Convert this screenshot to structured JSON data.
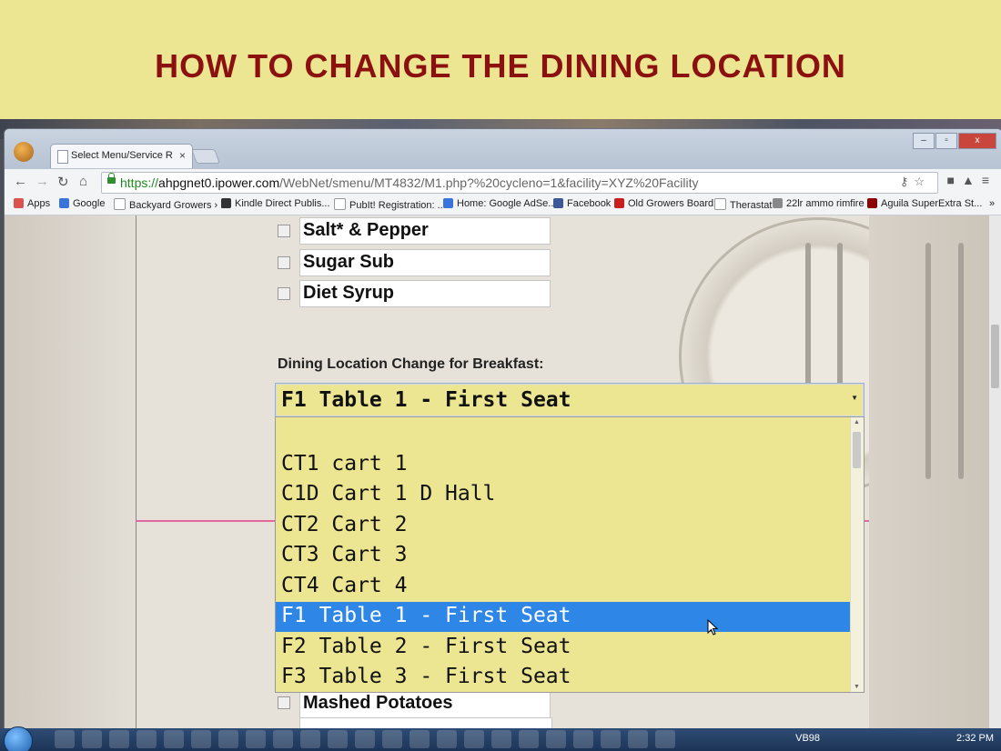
{
  "slide": {
    "title": "HOW TO CHANGE THE DINING LOCATION"
  },
  "browser": {
    "tab_title": "Select Menu/Service Requ",
    "tab_close": "×",
    "url_scheme": "https://",
    "url_host": "ahpgnet0.ipower.com",
    "url_path": "/WebNet/smenu/MT4832/M1.php?%20cycleno=1&facility=XYZ%20Facility",
    "window_controls": [
      "‒",
      "▫",
      "x"
    ],
    "bookmarks": [
      {
        "label": "Apps",
        "icon": "apps-grid-icon",
        "color": "#d9534f"
      },
      {
        "label": "Google",
        "icon": "google-icon",
        "color": "#3b74d8"
      },
      {
        "label": "Backyard Growers › ...",
        "icon": "page-icon",
        "color": "#ffffff"
      },
      {
        "label": "Kindle Direct Publis...",
        "icon": "kindle-icon",
        "color": "#333333"
      },
      {
        "label": "PubIt! Registration: ...",
        "icon": "page-icon",
        "color": "#ffffff"
      },
      {
        "label": "Home: Google AdSe...",
        "icon": "adsense-icon",
        "color": "#3b74d8"
      },
      {
        "label": "Facebook",
        "icon": "facebook-icon",
        "color": "#3b5998"
      },
      {
        "label": "Old Growers Board",
        "icon": "board-54-icon",
        "color": "#c81e1e"
      },
      {
        "label": "Therastat",
        "icon": "page-icon",
        "color": "#ffffff"
      },
      {
        "label": "22lr ammo rimfire",
        "icon": "ammo-icon",
        "color": "#888888"
      },
      {
        "label": "Aguila SuperExtra St...",
        "icon": "aguila-icon",
        "color": "#8b0000"
      }
    ],
    "bookmarks_overflow": "»"
  },
  "page": {
    "condiments": [
      {
        "label": "Salt* & Pepper",
        "checked": false
      },
      {
        "label": "Sugar Sub",
        "checked": false
      },
      {
        "label": "Diet Syrup",
        "checked": false
      }
    ],
    "dining_location_label": "Dining Location Change for Breakfast:",
    "dining_select": {
      "selected": "F1 Table 1 - First Seat",
      "options": [
        {
          "label": "",
          "selected": false
        },
        {
          "label": "CT1 cart 1",
          "selected": false
        },
        {
          "label": "C1D Cart 1 D Hall",
          "selected": false
        },
        {
          "label": "CT2 Cart 2",
          "selected": false
        },
        {
          "label": "CT3 Cart 3",
          "selected": false
        },
        {
          "label": "CT4 Cart 4",
          "selected": false
        },
        {
          "label": "F1 Table 1 - First Seat",
          "selected": true
        },
        {
          "label": "F2 Table 2 - First Seat",
          "selected": false
        },
        {
          "label": "F3 Table 3 - First Seat",
          "selected": false
        }
      ]
    },
    "below_item": {
      "label": "Mashed Potatoes",
      "checked": true
    }
  },
  "taskbar": {
    "tray_label": "VB98",
    "clock": "2:32 PM"
  },
  "colors": {
    "slide_bg": "#ece591",
    "title": "#8b1010",
    "select_bg": "#ece591",
    "option_highlight": "#2e86e6"
  }
}
